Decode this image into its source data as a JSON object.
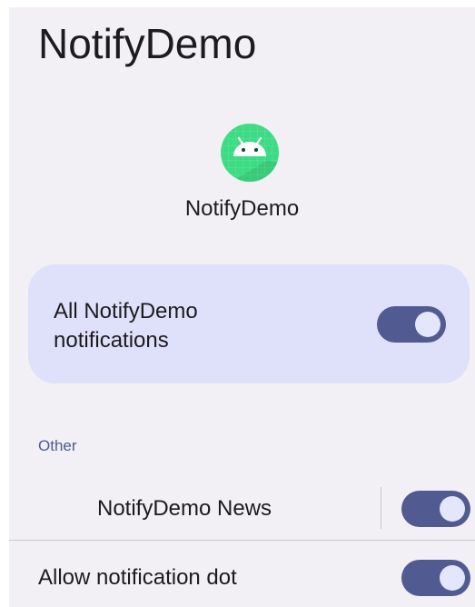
{
  "header": {
    "title": "NotifyDemo"
  },
  "app": {
    "icon": "android-robot-icon",
    "name": "NotifyDemo"
  },
  "master_toggle": {
    "label": "All NotifyDemo notifications",
    "enabled": true
  },
  "channels": {
    "section_title": "Other",
    "items": [
      {
        "label": "NotifyDemo News",
        "enabled": true
      }
    ]
  },
  "settings": {
    "notification_dot": {
      "label": "Allow notification dot",
      "enabled": true
    }
  },
  "colors": {
    "background": "#f2f0f4",
    "accent": "#525a92",
    "card": "#dfe0fa",
    "app_icon": "#3ddc84",
    "section_header": "#4d5a95"
  }
}
